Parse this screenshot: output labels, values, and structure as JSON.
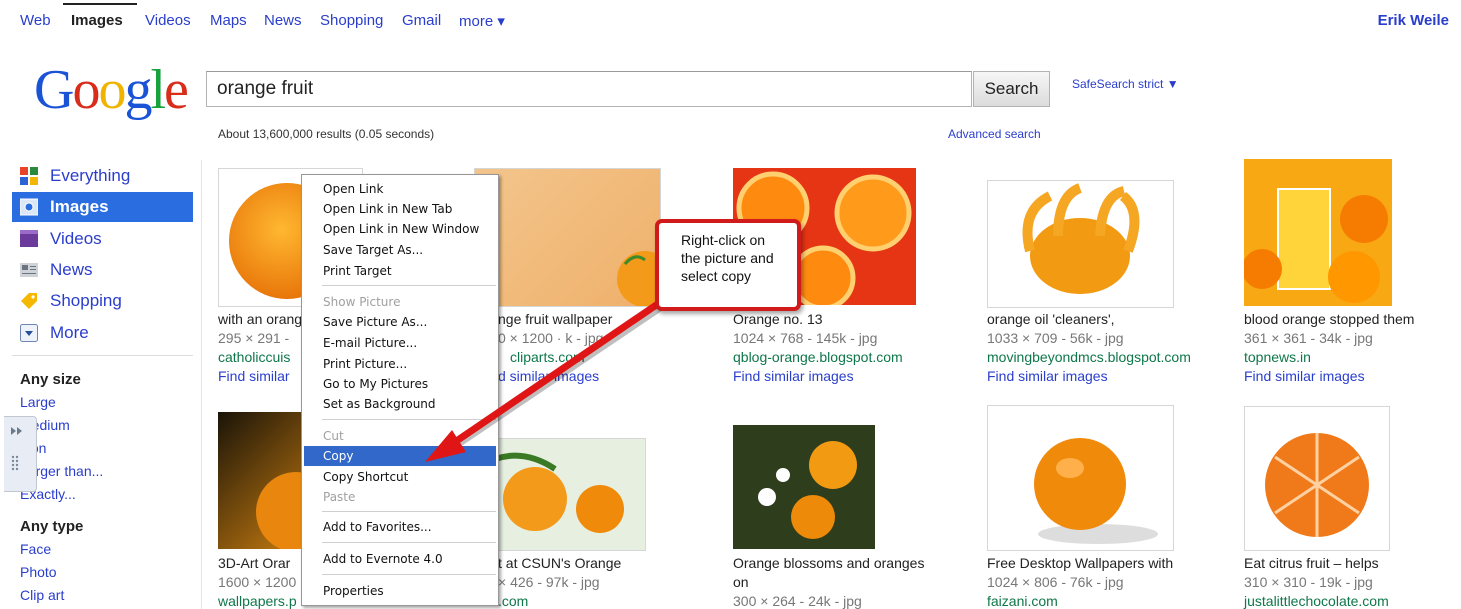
{
  "topnav": {
    "items": [
      "Web",
      "Images",
      "Videos",
      "Maps",
      "News",
      "Shopping",
      "Gmail",
      "more ▾"
    ],
    "user": "Erik Weile"
  },
  "logo": [
    "G",
    "o",
    "o",
    "g",
    "l",
    "e"
  ],
  "search": {
    "query": "orange fruit",
    "button": "Search",
    "safesearch": "SafeSearch strict ▼",
    "stats": "About 13,600,000 results (0.05 seconds)",
    "advanced": "Advanced search"
  },
  "sidebar": {
    "nav": [
      {
        "label": "Everything",
        "icon": "everything-icon"
      },
      {
        "label": "Images",
        "icon": "images-icon"
      },
      {
        "label": "Videos",
        "icon": "videos-icon"
      },
      {
        "label": "News",
        "icon": "news-icon"
      },
      {
        "label": "Shopping",
        "icon": "shopping-icon"
      },
      {
        "label": "More",
        "icon": "more-icon"
      }
    ],
    "size_heading": "Any size",
    "size_filters": [
      "Large",
      "Medium",
      "Icon",
      "Larger than...",
      "Exactly..."
    ],
    "type_heading": "Any type",
    "type_filters": [
      "Face",
      "Photo",
      "Clip art"
    ]
  },
  "results_row1": [
    {
      "title": "with an orange",
      "meta": "295 × 291 -",
      "host": "catholiccuis",
      "similar": "Find similar"
    },
    {
      "title": "nge fruit wallpaper",
      "meta": "0 × 1200 · k - jpg",
      "host": "cliparts.com",
      "similar": "d similar images"
    },
    {
      "title": "Orange no. 13",
      "meta": "1024 × 768 - 145k - jpg",
      "host": "qblog-orange.blogspot.com",
      "similar": "Find similar images"
    },
    {
      "title": "orange oil 'cleaners',",
      "meta": "1033 × 709 - 56k - jpg",
      "host": "movingbeyondmcs.blogspot.com",
      "similar": "Find similar images"
    },
    {
      "title": "blood orange stopped them",
      "meta": "361 × 361 - 34k - jpg",
      "host": "topnews.in",
      "similar": "Find similar images"
    }
  ],
  "results_row2": [
    {
      "title": "3D-Art Orar",
      "meta": "1600 × 1200",
      "host": "wallpapers.p"
    },
    {
      "title": "t at CSUN's Orange",
      "meta": "× 426 - 97k - jpg",
      "host": ".com"
    },
    {
      "title": "Orange blossoms and oranges",
      "title2": "on",
      "meta": "300 × 264 - 24k - jpg"
    },
    {
      "title": "Free Desktop Wallpapers with",
      "meta": "1024 × 806 - 76k - jpg",
      "host": "faizani.com"
    },
    {
      "title": "Eat citrus fruit – helps",
      "meta": "310 × 310 - 19k - jpg",
      "host": "justalittlechocolate.com"
    }
  ],
  "context_menu": [
    {
      "label": "Open Link",
      "state": "normal"
    },
    {
      "label": "Open Link in New Tab",
      "state": "normal"
    },
    {
      "label": "Open Link in New Window",
      "state": "normal"
    },
    {
      "label": "Save Target As...",
      "state": "normal"
    },
    {
      "label": "Print Target",
      "state": "normal"
    },
    {
      "label": "Show Picture",
      "state": "disabled"
    },
    {
      "label": "Save Picture As...",
      "state": "normal"
    },
    {
      "label": "E-mail Picture...",
      "state": "normal"
    },
    {
      "label": "Print Picture...",
      "state": "normal"
    },
    {
      "label": "Go to My Pictures",
      "state": "normal"
    },
    {
      "label": "Set as Background",
      "state": "normal"
    },
    {
      "label": "Cut",
      "state": "disabled"
    },
    {
      "label": "Copy",
      "state": "highlighted"
    },
    {
      "label": "Copy Shortcut",
      "state": "normal"
    },
    {
      "label": "Paste",
      "state": "disabled"
    },
    {
      "label": "Add to Favorites...",
      "state": "normal"
    },
    {
      "label": "Add to Evernote 4.0",
      "state": "normal"
    },
    {
      "label": "Properties",
      "state": "normal"
    }
  ],
  "callout": "Right-click on the picture and select copy",
  "colors": {
    "link": "#1122cc",
    "host": "#0e774a",
    "selected_nav": "#2a6de0",
    "callout_border": "#d11a1a",
    "menu_highlight": "#3168c9"
  }
}
